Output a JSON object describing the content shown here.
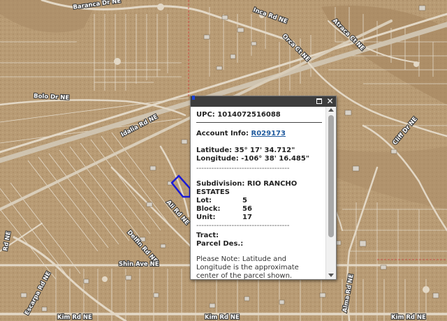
{
  "map": {
    "road_labels": {
      "baranca": "Baranca Dr NE",
      "inca": "Inca Rd NE",
      "atraca": "Atraca Ct NE",
      "orca": "Orca Ct NE",
      "bolo": "Bolo Dr NE",
      "idalia": "Idalia Rd NE",
      "cliff": "Cliff Dr NE",
      "ali": "Ali Rd NE",
      "delfin": "Delfin Rd NE",
      "shin": "Shin Ave NE",
      "escarpa": "Escarpa Rd NE",
      "alma": "Alma Rd NE",
      "kim_left": "Kim Rd NE",
      "kim_mid": "Kim Rd NE",
      "kim_right": "Kim Rd NE",
      "left_edge": "Rd NE"
    },
    "colors": {
      "terrain": "#b89b74",
      "road": "#e3d8c6",
      "parcel_line": "#f2eee6",
      "highlight": "#1b1bd6"
    }
  },
  "popup": {
    "maximize_icon": "maximize-icon",
    "close_icon": "close-icon",
    "close_glyph": "✕",
    "upc_label": "UPC:",
    "upc_value": "1014072516088",
    "account_label": "Account Info:",
    "account_value": "R029173",
    "latitude_label": "Latitude:",
    "latitude_value": "35° 17' 34.712\"",
    "longitude_label": "Longitude:",
    "longitude_value": "-106° 38' 16.485\"",
    "dashes": "-------------------------------------",
    "subdivision_label": "Subdivision:",
    "subdivision_value": "RIO RANCHO ESTATES",
    "lot_label": "Lot:",
    "lot_value": "5",
    "block_label": "Block:",
    "block_value": "56",
    "unit_label": "Unit:",
    "unit_value": "17",
    "tract_label": "Tract:",
    "parcel_des_label": "Parcel Des.:",
    "note": "Please Note: Latitude and Longitude is the approximate center of the parcel shown."
  }
}
